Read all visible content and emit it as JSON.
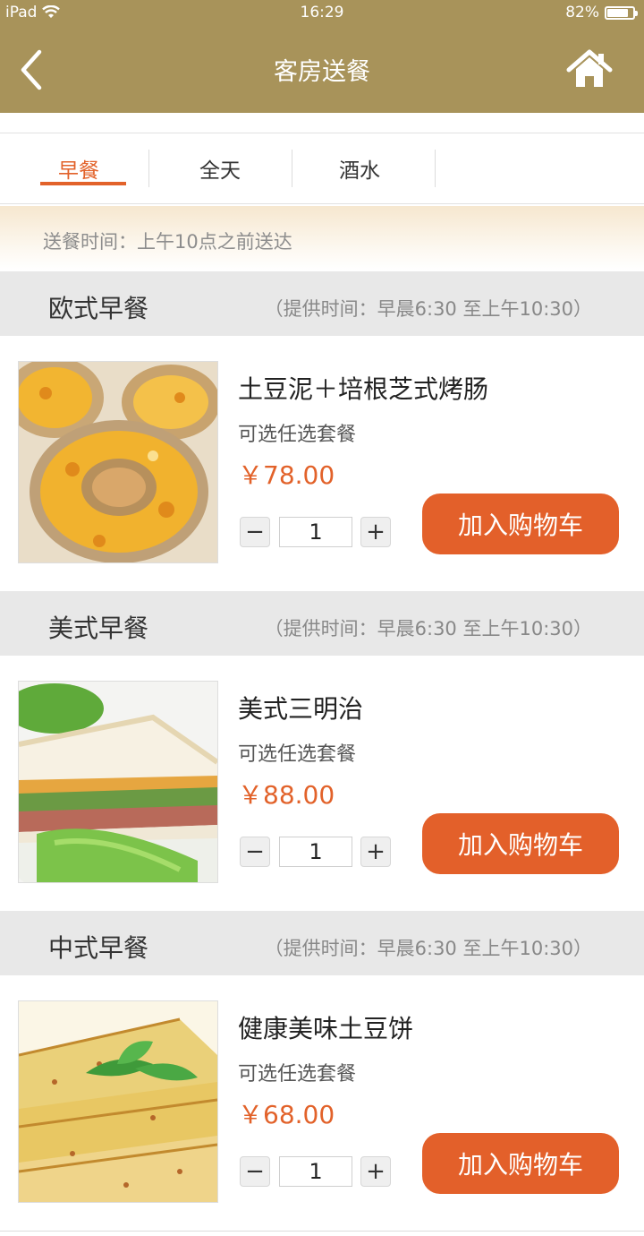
{
  "status": {
    "device": "iPad",
    "time": "16:29",
    "battery": "82%",
    "battery_level": 0.82
  },
  "header": {
    "title": "客房送餐",
    "back_icon": "chevron-left-icon",
    "home_icon": "home-icon"
  },
  "tabs": [
    {
      "label": "早餐",
      "active": true
    },
    {
      "label": "全天",
      "active": false
    },
    {
      "label": "酒水",
      "active": false
    }
  ],
  "delivery_note": "送餐时间：上午10点之前送达",
  "sections": [
    {
      "title": "欧式早餐",
      "hours": "（提供时间：早晨6:30 至上午10:30）",
      "item": {
        "name": "土豆泥＋培根芝式烤肠",
        "subtitle": "可选任选套餐",
        "price": "￥78.00",
        "qty": "1",
        "add_label": "加入购物车",
        "photo": "baked-potato-cheese-photo"
      }
    },
    {
      "title": "美式早餐",
      "hours": "（提供时间：早晨6:30 至上午10:30）",
      "item": {
        "name": "美式三明治",
        "subtitle": "可选任选套餐",
        "price": "￥88.00",
        "qty": "1",
        "add_label": "加入购物车",
        "photo": "sandwich-photo"
      }
    },
    {
      "title": "中式早餐",
      "hours": "（提供时间：早晨6:30 至上午10:30）",
      "item": {
        "name": "健康美味土豆饼",
        "subtitle": "可选任选套餐",
        "price": "￥68.00",
        "qty": "1",
        "add_label": "加入购物车",
        "photo": "potato-pancake-photo"
      }
    }
  ],
  "controls": {
    "minus": "−",
    "plus": "+"
  },
  "colors": {
    "header_bg": "#a8935a",
    "accent": "#e2622a",
    "section_bg": "#e8e8e8"
  }
}
